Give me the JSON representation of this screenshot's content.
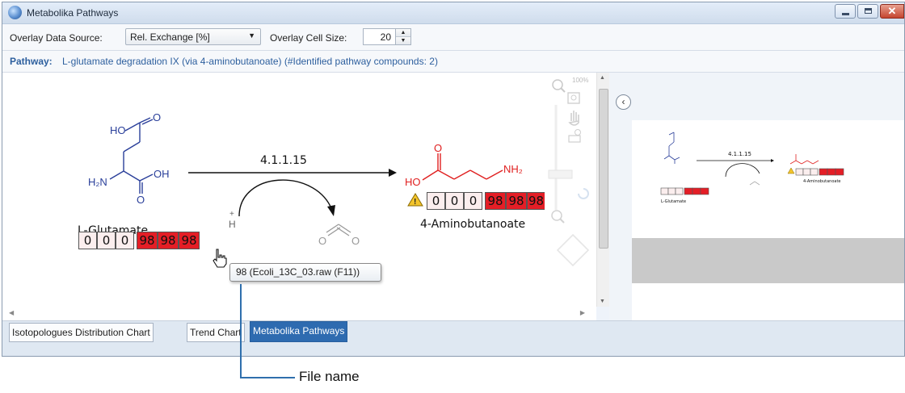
{
  "window": {
    "title": "Metabolika Pathways"
  },
  "toolbar": {
    "overlay_source_label": "Overlay Data Source:",
    "overlay_source_value": "Rel. Exchange [%]",
    "cell_size_label": "Overlay Cell Size:",
    "cell_size_value": "20"
  },
  "pathway": {
    "label": "Pathway:",
    "value": "L-glutamate degradation IX (via 4-aminobutanoate) (#Identified pathway compounds: 2)"
  },
  "diagram": {
    "enzyme": "4.1.1.15",
    "substrate": {
      "name": "L-Glutamate",
      "atoms": {
        "ho": "HO",
        "o_top": "O",
        "oh": "OH",
        "h2n": "H₂N",
        "o_bottom": "O"
      },
      "cells": [
        "0",
        "0",
        "0",
        "98",
        "98",
        "98"
      ]
    },
    "product": {
      "name": "4-Aminobutanoate",
      "atoms": {
        "o": "O",
        "ho": "HO",
        "nh2": "NH₂"
      },
      "cells": [
        "0",
        "0",
        "0",
        "98",
        "98",
        "98"
      ]
    },
    "byproduct_atoms": {
      "o_left": "O",
      "o_right": "O"
    },
    "hydrogen": {
      "plus": "+",
      "h": "H"
    }
  },
  "zoom": {
    "level": "100%"
  },
  "tooltip": {
    "text": "98 (Ecoli_13C_03.raw (F11))"
  },
  "preview": {
    "enzyme": "4.1.1.15",
    "substrate_name": "L-Glutamate",
    "product_name": "4-Aminobutanoate"
  },
  "tabs": [
    {
      "label": "Isotopologues Distribution Chart",
      "active": false
    },
    {
      "label": "Trend Chart",
      "active": false
    },
    {
      "label": "Metabolika Pathways",
      "active": true
    }
  ],
  "callout": {
    "label": "File name"
  },
  "colors": {
    "accent": "#2e6bb0",
    "red_cell": "#e41e26",
    "bond_blue": "#2a3f9a",
    "bond_red": "#e02020"
  }
}
